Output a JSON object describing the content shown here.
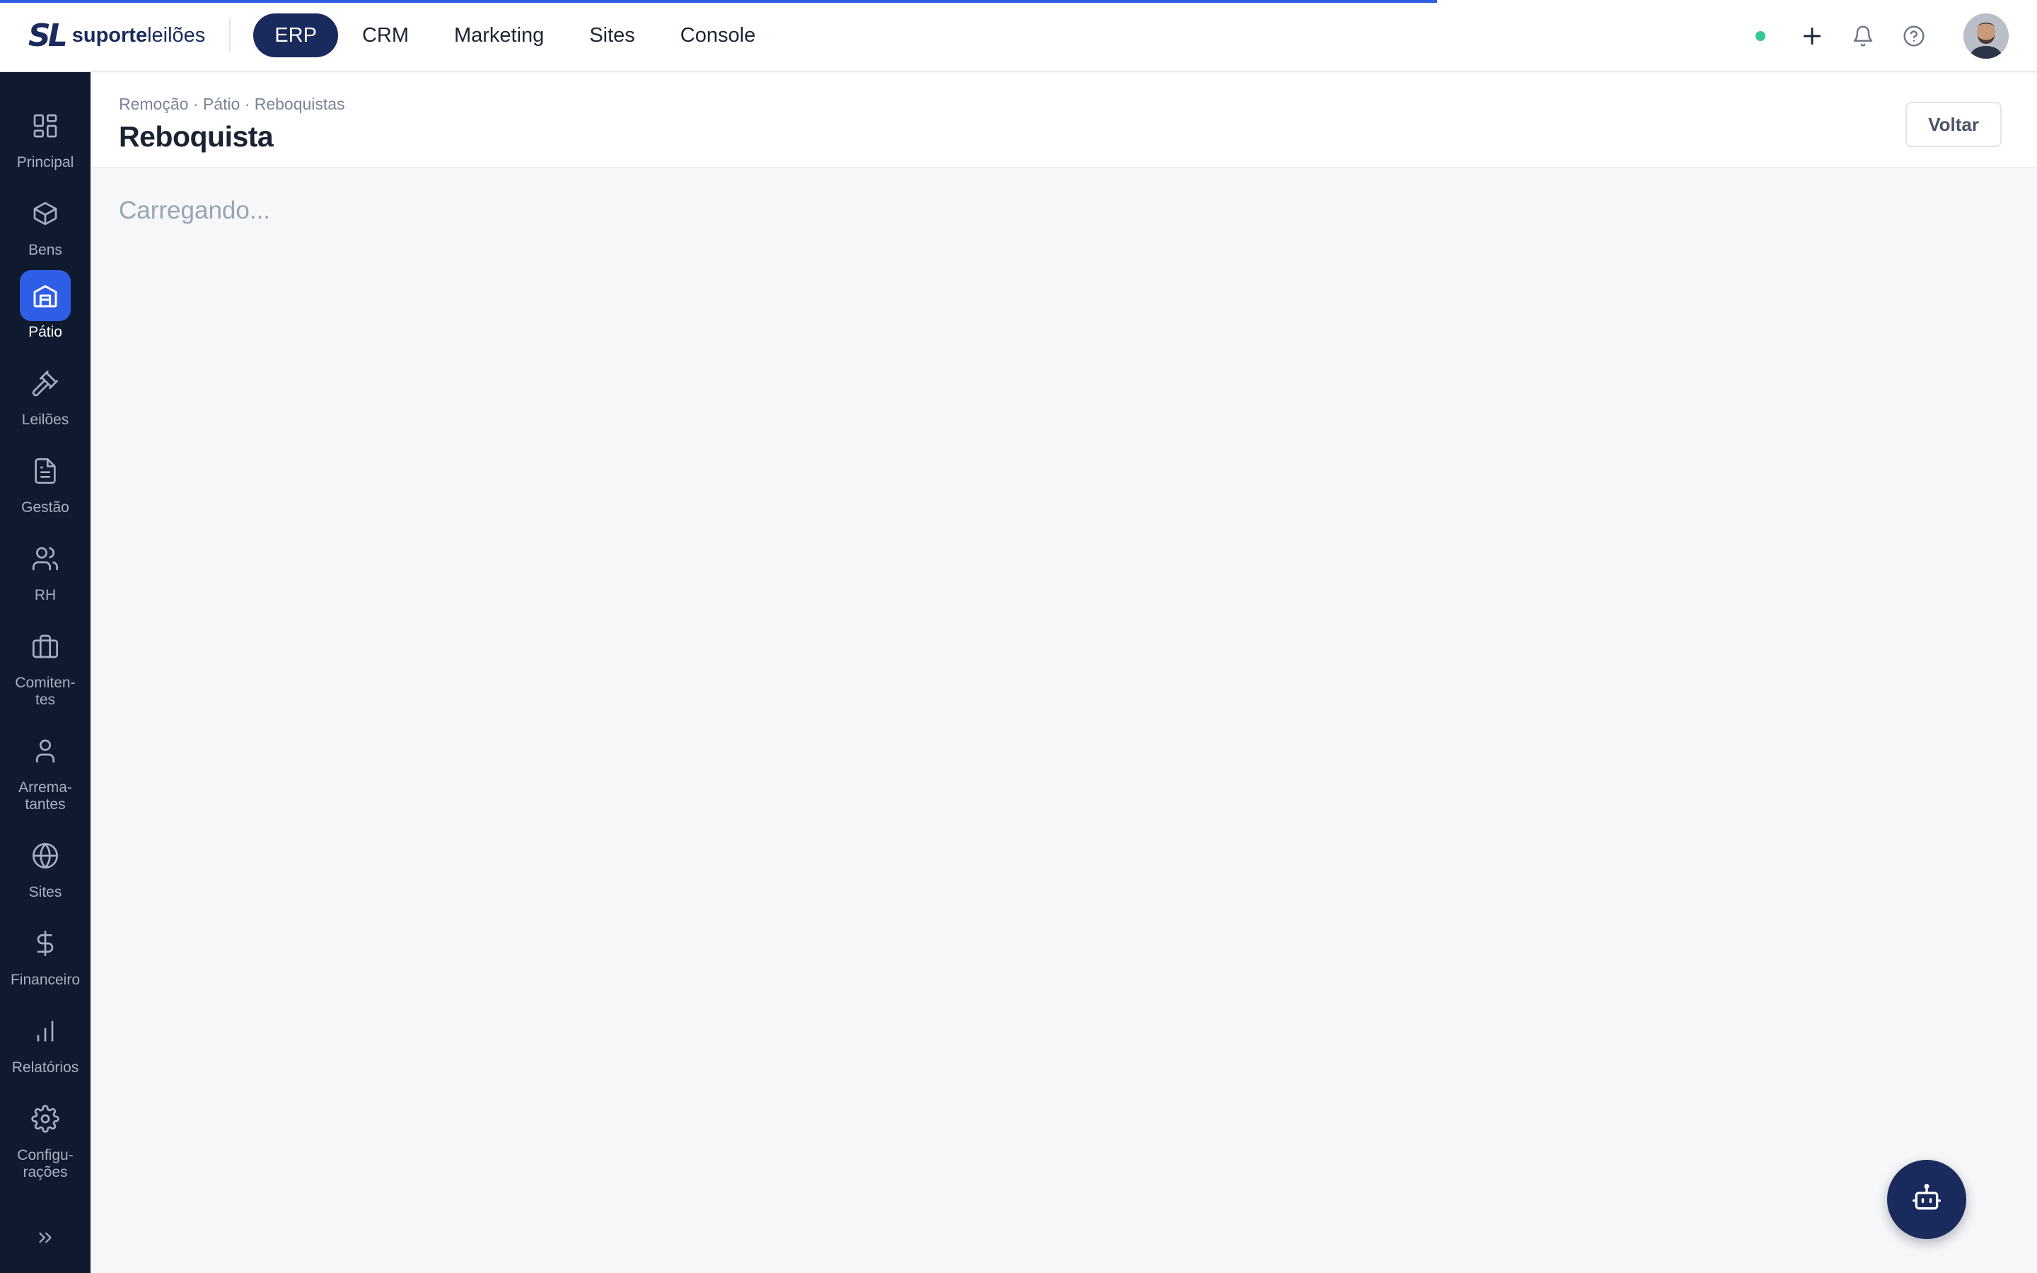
{
  "logo": {
    "mark": "SL",
    "text_bold": "suporte",
    "text_regular": "leilões"
  },
  "topnav": [
    {
      "label": "ERP",
      "active": true
    },
    {
      "label": "CRM",
      "active": false
    },
    {
      "label": "Marketing",
      "active": false
    },
    {
      "label": "Sites",
      "active": false
    },
    {
      "label": "Console",
      "active": false
    }
  ],
  "status_color": "#34c98e",
  "sidebar": {
    "items": [
      {
        "label": "Principal",
        "icon": "grid-icon"
      },
      {
        "label": "Bens",
        "icon": "box-icon"
      },
      {
        "label": "Pátio",
        "icon": "warehouse-icon",
        "active": true
      },
      {
        "label": "Leilões",
        "icon": "gavel-icon"
      },
      {
        "label": "Gestão",
        "icon": "document-icon"
      },
      {
        "label": "RH",
        "icon": "users-icon"
      },
      {
        "label": "Comiten-\ntes",
        "icon": "briefcase-icon"
      },
      {
        "label": "Arrema-\ntantes",
        "icon": "user-icon"
      },
      {
        "label": "Sites",
        "icon": "globe-icon"
      },
      {
        "label": "Financeiro",
        "icon": "dollar-icon"
      },
      {
        "label": "Relatórios",
        "icon": "bar-chart-icon"
      },
      {
        "label": "Configu-\nrações",
        "icon": "gear-icon"
      }
    ]
  },
  "header": {
    "breadcrumb": "Remoção · Pátio · Reboquistas",
    "title": "Reboquista",
    "back_label": "Voltar"
  },
  "main": {
    "loading": "Carregando..."
  },
  "accent_color": "#2f5ee6",
  "brand_color": "#1a2a5c"
}
